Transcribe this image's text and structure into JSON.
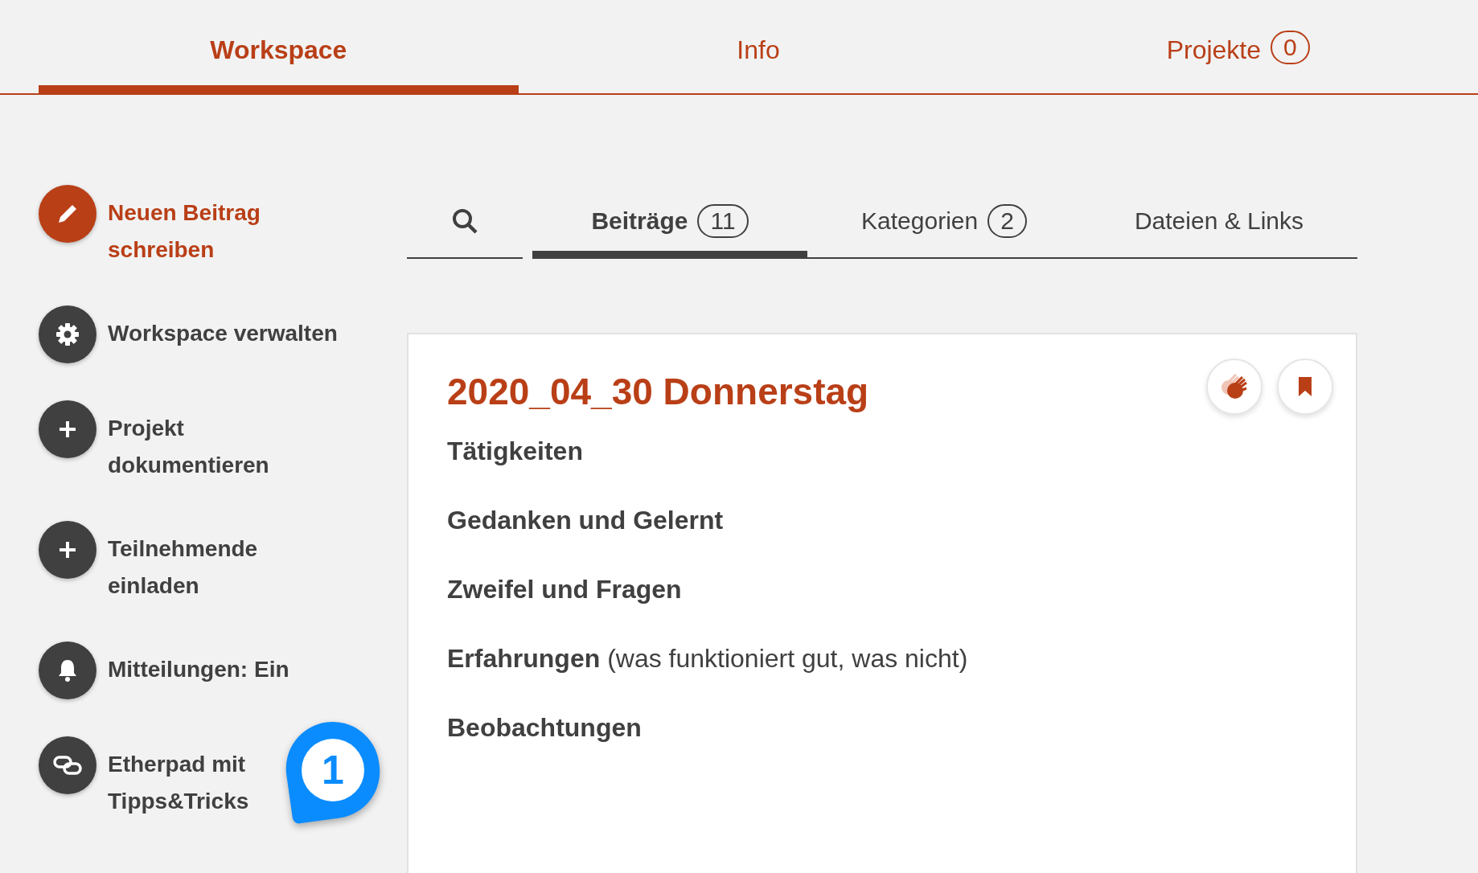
{
  "main_tabs": [
    {
      "label": "Workspace",
      "selected": true
    },
    {
      "label": "Info",
      "selected": false
    },
    {
      "label": "Projekte",
      "count": "0",
      "selected": false
    }
  ],
  "sidebar": {
    "items": [
      {
        "kind": "pencil",
        "label": "Neuen Beitrag schreiben",
        "primary": true
      },
      {
        "kind": "gear",
        "label": "Workspace verwalten",
        "primary": false
      },
      {
        "kind": "plus",
        "label": "Projekt dokumentieren",
        "primary": false
      },
      {
        "kind": "plus",
        "label": "Teilnehmende einladen",
        "primary": false
      },
      {
        "kind": "bell",
        "label": "Mitteilungen: Ein",
        "primary": false
      },
      {
        "kind": "link",
        "label": "Etherpad mit Tipps&Tricks",
        "primary": false
      }
    ]
  },
  "sub_tabs": [
    {
      "kind": "search",
      "selected": false
    },
    {
      "kind": "text",
      "label": "Beiträge",
      "count": "11",
      "selected": true
    },
    {
      "kind": "text",
      "label": "Kategorien",
      "count": "2",
      "selected": false
    },
    {
      "kind": "text",
      "label": "Dateien & Links",
      "selected": false
    }
  ],
  "post": {
    "title": "2020_04_30 Donnerstag",
    "actions": [
      {
        "kind": "clap"
      },
      {
        "kind": "bookmark"
      }
    ],
    "sections": [
      {
        "text": "Tätigkeiten"
      },
      {
        "text": "Gedanken und Gelernt"
      },
      {
        "text": "Zweifel und Fragen"
      },
      {
        "text": "Erfahrungen",
        "note": "(was funktioniert gut, was nicht)"
      },
      {
        "text": "Beobachtungen"
      }
    ]
  },
  "marker": {
    "label": "1"
  }
}
